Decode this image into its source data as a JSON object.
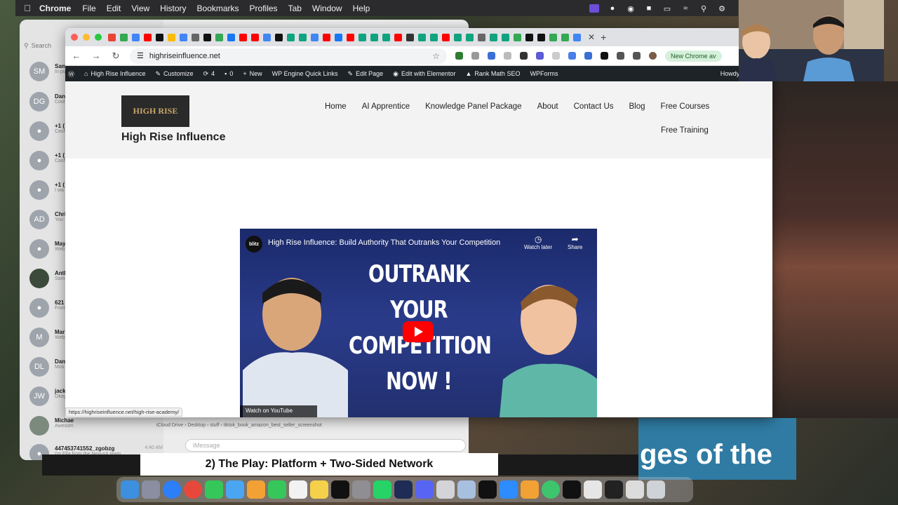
{
  "menubar": {
    "app": "Chrome",
    "items": [
      "File",
      "Edit",
      "View",
      "History",
      "Bookmarks",
      "Profiles",
      "Tab",
      "Window",
      "Help"
    ]
  },
  "messages": {
    "search_placeholder": "Search",
    "conversations": [
      {
        "initials": "SM",
        "name": "Sam",
        "preview": "In pu... Co..."
      },
      {
        "initials": "DG",
        "name": "Dan",
        "preview": "Cool"
      },
      {
        "initials": "",
        "name": "+1 (",
        "preview": "Cash"
      },
      {
        "initials": "",
        "name": "+1 (",
        "preview": "Cash you."
      },
      {
        "initials": "",
        "name": "+1 (",
        "preview": "I wa now,"
      },
      {
        "initials": "AD",
        "name": "Chri",
        "preview": "You"
      },
      {
        "initials": "",
        "name": "May",
        "preview": "Web (you"
      },
      {
        "initials": "",
        "name": "Anth",
        "preview": "Sam one"
      },
      {
        "initials": "",
        "name": "621",
        "preview": "From 303"
      },
      {
        "initials": "M",
        "name": "Mar",
        "preview": "Web"
      },
      {
        "initials": "DL",
        "name": "Dan",
        "preview": "Mos"
      },
      {
        "initials": "JW",
        "name": "jack",
        "preview": "Okay"
      },
      {
        "initials": "",
        "name": "Michae",
        "preview": "Awesom"
      },
      {
        "initials": "",
        "name": "447453741552_zgobzg",
        "preview": "I'm Ella from the NexusX team.",
        "time": "4:40 AM"
      }
    ],
    "compose_placeholder": "iMessage",
    "path": [
      "iCloud Drive",
      "Desktop",
      "stuff",
      "tiktok_book_amazon_best_seller_screenshot"
    ]
  },
  "chrome": {
    "url": "highriseinfluence.net",
    "new_chrome_label": "New Chrome av",
    "status_url": "https://highriseinfluence.net/high-rise-academy/"
  },
  "wpbar": {
    "site": "High Rise Influence",
    "customize": "Customize",
    "updates": "4",
    "comments": "0",
    "new": "New",
    "wp_engine": "WP Engine Quick Links",
    "edit_page": "Edit Page",
    "elementor": "Edit with Elementor",
    "rank_math": "Rank Math SEO",
    "wpforms": "WPForms",
    "howdy": "Howdy, Dennis Y"
  },
  "site": {
    "logo_text": "HIGH RISE",
    "title": "High Rise Influence",
    "nav": [
      "Home",
      "AI Apprentice",
      "Knowledge Panel Package",
      "About",
      "Contact Us",
      "Blog",
      "Free Courses"
    ],
    "nav_second_row": "Free Training",
    "video": {
      "channel": "blitz",
      "title": "High Rise Influence: Build Authority That Outranks Your Competition",
      "watch_later": "Watch later",
      "share": "Share",
      "headline": [
        "OUTRANK",
        "YOUR",
        "COMPETITION",
        "NOW !"
      ],
      "watch_on": "Watch on YouTube"
    }
  },
  "caption": "2) The Play: Platform + Two-Sided Network",
  "side_banner_text": "ges of the",
  "colors": {
    "wp_bar": "#1d2327",
    "video_bg": "#22306f",
    "play_red": "#ff0000",
    "side_banner": "#2f7ba3"
  }
}
